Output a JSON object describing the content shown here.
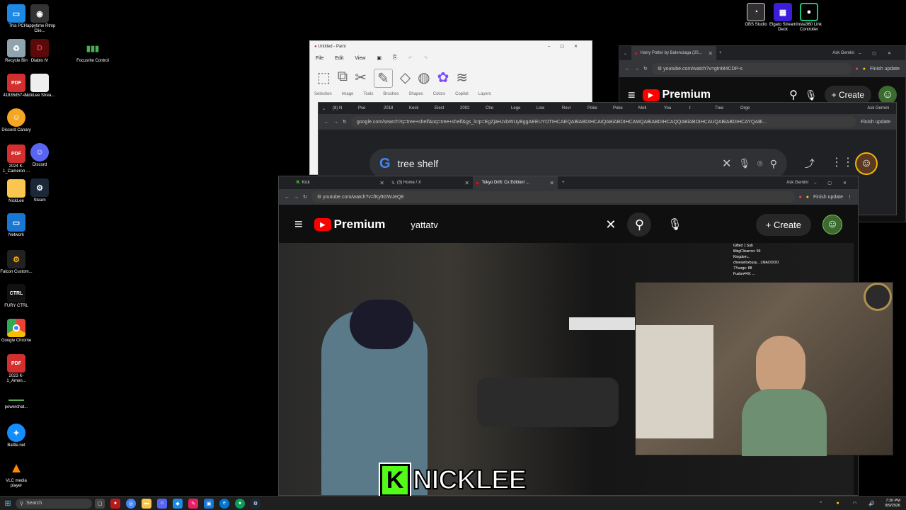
{
  "desktop": {
    "icons_col1": [
      {
        "label": "This PC"
      },
      {
        "label": "Recycle Bin"
      },
      {
        "label": "41835d57-e..."
      },
      {
        "label": "Discord Canary"
      },
      {
        "label": "2024 K-1_Cameron ..."
      },
      {
        "label": "NickLee"
      },
      {
        "label": "Network"
      },
      {
        "label": "Falcon Custom..."
      },
      {
        "label": "FURY CTRL"
      },
      {
        "label": "Google Chrome"
      },
      {
        "label": "2023 K-1_Amen..."
      },
      {
        "label": "powerchat..."
      },
      {
        "label": "Battle.net"
      },
      {
        "label": "VLC media player"
      }
    ],
    "icons_col2": [
      {
        "label": "Happytime Rtmp Clie..."
      },
      {
        "label": "Diablo IV"
      },
      {
        "label": "NickLee Strea..."
      },
      {
        "label": "Discord"
      },
      {
        "label": "Steam"
      }
    ],
    "icon_col3": {
      "label": "Focusrite Control"
    },
    "icons_top_right": [
      {
        "label": "OBS Studio"
      },
      {
        "label": "Elgato Stream Deck"
      },
      {
        "label": "Insta360 Link Controller"
      }
    ]
  },
  "paint": {
    "title": "Untitled - Paint",
    "menu": [
      "File",
      "Edit",
      "View"
    ],
    "groups": [
      "Selection",
      "Image",
      "Tools",
      "Brushes",
      "Shapes",
      "Colors",
      "Copilot",
      "Layers"
    ]
  },
  "browser_back": {
    "tab": "Harry Potter by Balenciaga (20...",
    "ask": "Ask Gemini",
    "url": "youtube.com/watch?v=gtnt84CDP-s",
    "finish": "Finish update",
    "yt_brand": "Premium",
    "create": "Create"
  },
  "browser_google": {
    "tabs": [
      "(8) N",
      "Pse",
      "2018",
      "Keck",
      "Elect",
      "2002",
      "Che",
      "Lege",
      "Low",
      "Revi",
      "Poke",
      "Poke",
      "Moti",
      "You",
      "t",
      "Tree",
      "Orge"
    ],
    "ask": "Ask Gemini",
    "url": "google.com/search?q=tree+shelf&oq=tree+shelf&gs_lcrp=EgZjaHJvbWUyBggAEEUYOTIHCAEQABiABDIHCAIQABiABDIHCAMQABiABDIHCAQQABiABDIHCAUQABiABDIHCAYQABi...",
    "finish": "Finish update",
    "query": "tree shelf"
  },
  "browser_front": {
    "tabs": [
      {
        "label": "Kick"
      },
      {
        "label": "(3) Home / X"
      },
      {
        "label": "Tokyo Drift: Cx Edition! ..."
      }
    ],
    "ask": "Ask Gemini",
    "url": "youtube.com/watch?v=fKyltGWJeQ8",
    "finish": "Finish update",
    "yt_brand": "Premium",
    "search_value": "yattatv",
    "create": "Create"
  },
  "stream_overlay": {
    "chat": [
      "Gifted 1 Sub",
      "lilbigClixarroo: 99",
      "Kingdom...",
      "cheesefoxbusy... LMAOOOO",
      "77surge: 88",
      "Fuslon44X: ..."
    ],
    "logo_letter": "K",
    "streamer": "NICKLEE"
  },
  "taskbar": {
    "search_placeholder": "Search",
    "time": "7:20 PM",
    "date": "8/9/2026"
  },
  "colors": {
    "kick_green": "#53fc18",
    "yt_red": "#ff0000",
    "dark": "#0f0f0f"
  }
}
